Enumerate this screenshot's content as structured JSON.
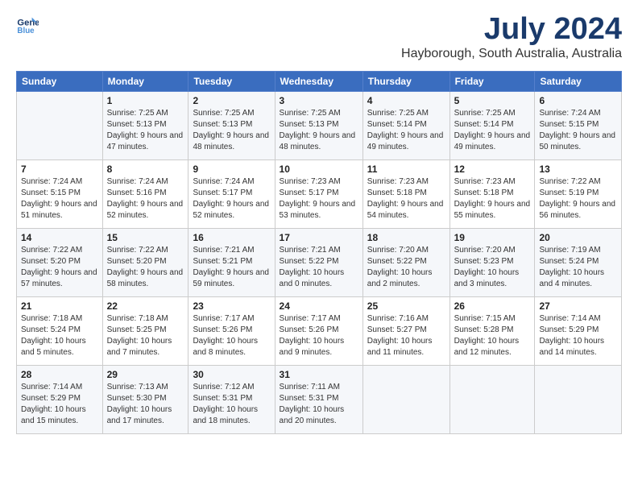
{
  "header": {
    "logo_line1": "General",
    "logo_line2": "Blue",
    "month": "July 2024",
    "location": "Hayborough, South Australia, Australia"
  },
  "days_of_week": [
    "Sunday",
    "Monday",
    "Tuesday",
    "Wednesday",
    "Thursday",
    "Friday",
    "Saturday"
  ],
  "weeks": [
    [
      {
        "day": "",
        "sunrise": "",
        "sunset": "",
        "daylight": ""
      },
      {
        "day": "1",
        "sunrise": "Sunrise: 7:25 AM",
        "sunset": "Sunset: 5:13 PM",
        "daylight": "Daylight: 9 hours and 47 minutes."
      },
      {
        "day": "2",
        "sunrise": "Sunrise: 7:25 AM",
        "sunset": "Sunset: 5:13 PM",
        "daylight": "Daylight: 9 hours and 48 minutes."
      },
      {
        "day": "3",
        "sunrise": "Sunrise: 7:25 AM",
        "sunset": "Sunset: 5:13 PM",
        "daylight": "Daylight: 9 hours and 48 minutes."
      },
      {
        "day": "4",
        "sunrise": "Sunrise: 7:25 AM",
        "sunset": "Sunset: 5:14 PM",
        "daylight": "Daylight: 9 hours and 49 minutes."
      },
      {
        "day": "5",
        "sunrise": "Sunrise: 7:25 AM",
        "sunset": "Sunset: 5:14 PM",
        "daylight": "Daylight: 9 hours and 49 minutes."
      },
      {
        "day": "6",
        "sunrise": "Sunrise: 7:24 AM",
        "sunset": "Sunset: 5:15 PM",
        "daylight": "Daylight: 9 hours and 50 minutes."
      }
    ],
    [
      {
        "day": "7",
        "sunrise": "Sunrise: 7:24 AM",
        "sunset": "Sunset: 5:15 PM",
        "daylight": "Daylight: 9 hours and 51 minutes."
      },
      {
        "day": "8",
        "sunrise": "Sunrise: 7:24 AM",
        "sunset": "Sunset: 5:16 PM",
        "daylight": "Daylight: 9 hours and 52 minutes."
      },
      {
        "day": "9",
        "sunrise": "Sunrise: 7:24 AM",
        "sunset": "Sunset: 5:17 PM",
        "daylight": "Daylight: 9 hours and 52 minutes."
      },
      {
        "day": "10",
        "sunrise": "Sunrise: 7:23 AM",
        "sunset": "Sunset: 5:17 PM",
        "daylight": "Daylight: 9 hours and 53 minutes."
      },
      {
        "day": "11",
        "sunrise": "Sunrise: 7:23 AM",
        "sunset": "Sunset: 5:18 PM",
        "daylight": "Daylight: 9 hours and 54 minutes."
      },
      {
        "day": "12",
        "sunrise": "Sunrise: 7:23 AM",
        "sunset": "Sunset: 5:18 PM",
        "daylight": "Daylight: 9 hours and 55 minutes."
      },
      {
        "day": "13",
        "sunrise": "Sunrise: 7:22 AM",
        "sunset": "Sunset: 5:19 PM",
        "daylight": "Daylight: 9 hours and 56 minutes."
      }
    ],
    [
      {
        "day": "14",
        "sunrise": "Sunrise: 7:22 AM",
        "sunset": "Sunset: 5:20 PM",
        "daylight": "Daylight: 9 hours and 57 minutes."
      },
      {
        "day": "15",
        "sunrise": "Sunrise: 7:22 AM",
        "sunset": "Sunset: 5:20 PM",
        "daylight": "Daylight: 9 hours and 58 minutes."
      },
      {
        "day": "16",
        "sunrise": "Sunrise: 7:21 AM",
        "sunset": "Sunset: 5:21 PM",
        "daylight": "Daylight: 9 hours and 59 minutes."
      },
      {
        "day": "17",
        "sunrise": "Sunrise: 7:21 AM",
        "sunset": "Sunset: 5:22 PM",
        "daylight": "Daylight: 10 hours and 0 minutes."
      },
      {
        "day": "18",
        "sunrise": "Sunrise: 7:20 AM",
        "sunset": "Sunset: 5:22 PM",
        "daylight": "Daylight: 10 hours and 2 minutes."
      },
      {
        "day": "19",
        "sunrise": "Sunrise: 7:20 AM",
        "sunset": "Sunset: 5:23 PM",
        "daylight": "Daylight: 10 hours and 3 minutes."
      },
      {
        "day": "20",
        "sunrise": "Sunrise: 7:19 AM",
        "sunset": "Sunset: 5:24 PM",
        "daylight": "Daylight: 10 hours and 4 minutes."
      }
    ],
    [
      {
        "day": "21",
        "sunrise": "Sunrise: 7:18 AM",
        "sunset": "Sunset: 5:24 PM",
        "daylight": "Daylight: 10 hours and 5 minutes."
      },
      {
        "day": "22",
        "sunrise": "Sunrise: 7:18 AM",
        "sunset": "Sunset: 5:25 PM",
        "daylight": "Daylight: 10 hours and 7 minutes."
      },
      {
        "day": "23",
        "sunrise": "Sunrise: 7:17 AM",
        "sunset": "Sunset: 5:26 PM",
        "daylight": "Daylight: 10 hours and 8 minutes."
      },
      {
        "day": "24",
        "sunrise": "Sunrise: 7:17 AM",
        "sunset": "Sunset: 5:26 PM",
        "daylight": "Daylight: 10 hours and 9 minutes."
      },
      {
        "day": "25",
        "sunrise": "Sunrise: 7:16 AM",
        "sunset": "Sunset: 5:27 PM",
        "daylight": "Daylight: 10 hours and 11 minutes."
      },
      {
        "day": "26",
        "sunrise": "Sunrise: 7:15 AM",
        "sunset": "Sunset: 5:28 PM",
        "daylight": "Daylight: 10 hours and 12 minutes."
      },
      {
        "day": "27",
        "sunrise": "Sunrise: 7:14 AM",
        "sunset": "Sunset: 5:29 PM",
        "daylight": "Daylight: 10 hours and 14 minutes."
      }
    ],
    [
      {
        "day": "28",
        "sunrise": "Sunrise: 7:14 AM",
        "sunset": "Sunset: 5:29 PM",
        "daylight": "Daylight: 10 hours and 15 minutes."
      },
      {
        "day": "29",
        "sunrise": "Sunrise: 7:13 AM",
        "sunset": "Sunset: 5:30 PM",
        "daylight": "Daylight: 10 hours and 17 minutes."
      },
      {
        "day": "30",
        "sunrise": "Sunrise: 7:12 AM",
        "sunset": "Sunset: 5:31 PM",
        "daylight": "Daylight: 10 hours and 18 minutes."
      },
      {
        "day": "31",
        "sunrise": "Sunrise: 7:11 AM",
        "sunset": "Sunset: 5:31 PM",
        "daylight": "Daylight: 10 hours and 20 minutes."
      },
      {
        "day": "",
        "sunrise": "",
        "sunset": "",
        "daylight": ""
      },
      {
        "day": "",
        "sunrise": "",
        "sunset": "",
        "daylight": ""
      },
      {
        "day": "",
        "sunrise": "",
        "sunset": "",
        "daylight": ""
      }
    ]
  ]
}
